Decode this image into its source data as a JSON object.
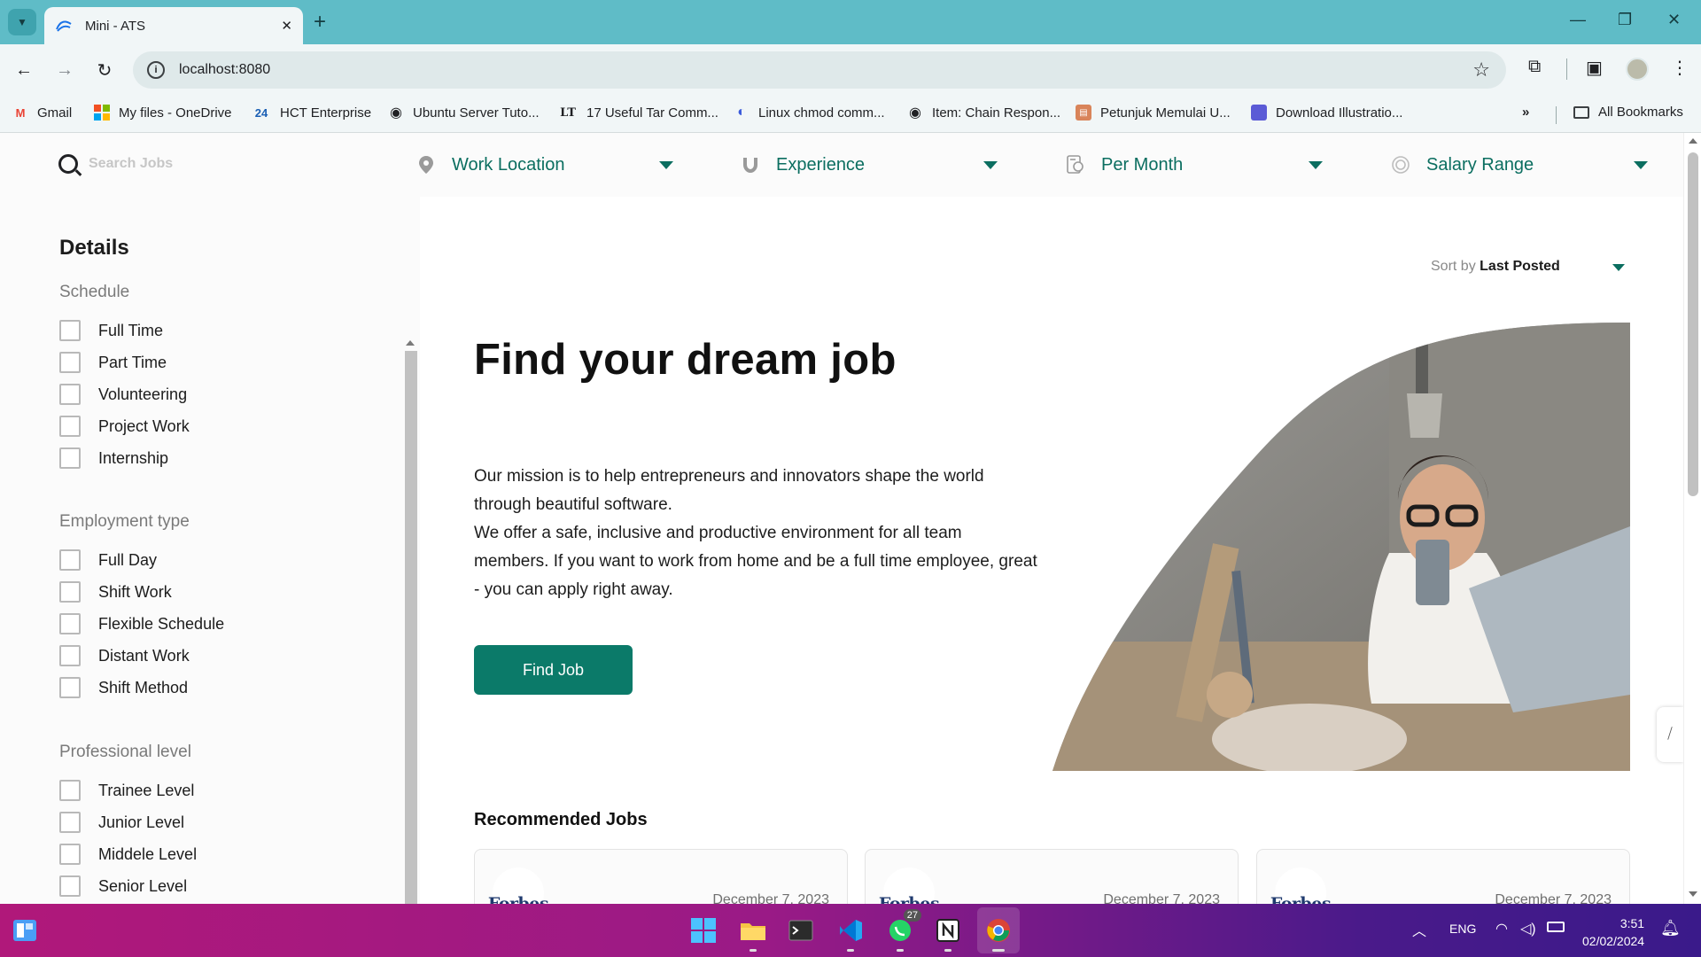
{
  "browser": {
    "tab_title": "Mini - ATS",
    "url": "localhost:8080",
    "bookmarks": [
      {
        "label": "Gmail",
        "icon": "gmail-icon"
      },
      {
        "label": "My files - OneDrive",
        "icon": "microsoft-icon"
      },
      {
        "label": "HCT Enterprise",
        "icon": "24-icon"
      },
      {
        "label": "Ubuntu Server Tuto...",
        "icon": "globe-icon"
      },
      {
        "label": "17 Useful Tar Comm...",
        "icon": "lt-icon"
      },
      {
        "label": "Linux chmod comm...",
        "icon": "circle-icon"
      },
      {
        "label": "Item: Chain Respon...",
        "icon": "globe-icon"
      },
      {
        "label": "Petunjuk Memulai U...",
        "icon": "book-icon"
      },
      {
        "label": "Download Illustratio...",
        "icon": "square-icon"
      }
    ],
    "all_bookmarks": "All Bookmarks"
  },
  "filters": {
    "search_placeholder": "Search Jobs",
    "work_location": "Work Location",
    "experience": "Experience",
    "per_month": "Per Month",
    "salary_range": "Salary Range"
  },
  "sidebar": {
    "title": "Details",
    "schedule": {
      "title": "Schedule",
      "items": [
        "Full Time",
        "Part Time",
        "Volunteering",
        "Project Work",
        "Internship"
      ]
    },
    "employment": {
      "title": "Employment type",
      "items": [
        "Full Day",
        "Shift Work",
        "Flexible Schedule",
        "Distant Work",
        "Shift Method"
      ]
    },
    "level": {
      "title": "Professional level",
      "items": [
        "Trainee Level",
        "Junior Level",
        "Middele Level",
        "Senior Level"
      ]
    }
  },
  "main": {
    "sort_prefix": "Sort by",
    "sort_value": "Last Posted",
    "hero_title": "Find your dream job",
    "hero_p1": "Our mission is to help entrepreneurs and innovators shape the world through beautiful software.",
    "hero_p2": "We offer a safe, inclusive and productive environment for all team members. If you want to work from home and be a full time employee, great - you can apply right away.",
    "find_button": "Find Job",
    "recommended_title": "Recommended Jobs",
    "cards": [
      {
        "company": "Forbes",
        "date": "December 7, 2023"
      },
      {
        "company": "Forbes",
        "date": "December 7, 2023"
      },
      {
        "company": "Forbes",
        "date": "December 7, 2023"
      }
    ]
  },
  "taskbar": {
    "whatsapp_badge": "27",
    "language": "ENG",
    "time": "3:51",
    "date": "02/02/2024"
  },
  "colors": {
    "accent": "#0b7a69",
    "tabbar": "#5fbcc7"
  }
}
